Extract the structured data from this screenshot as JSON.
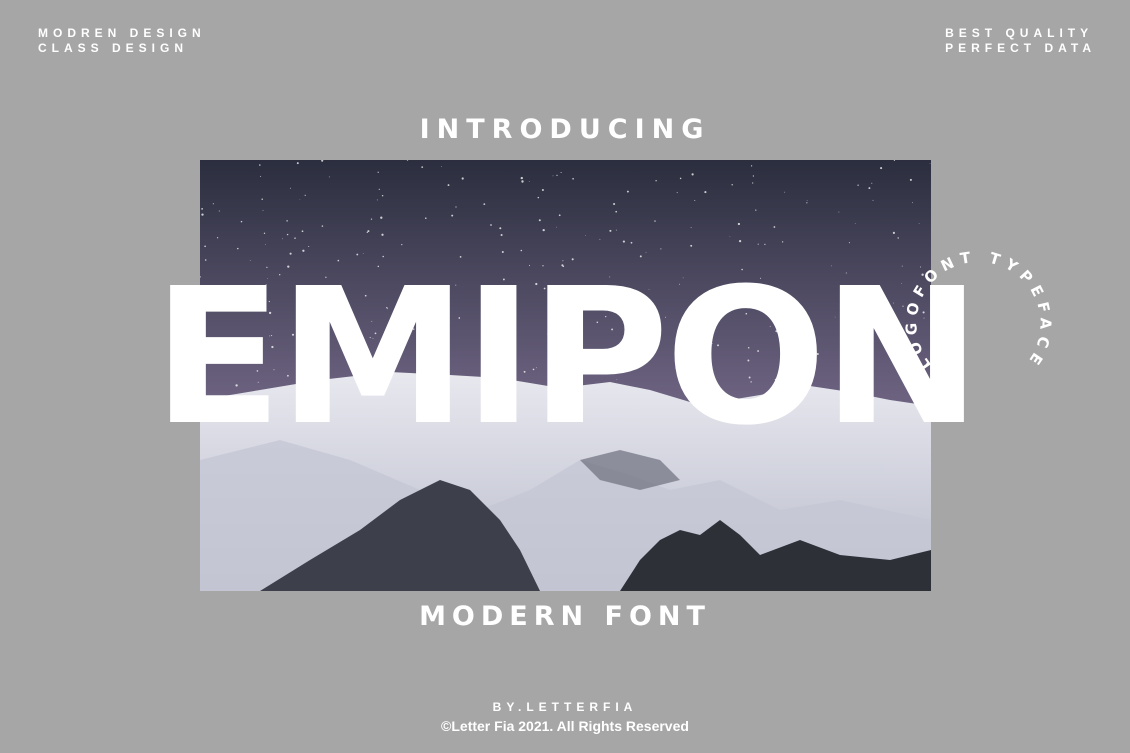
{
  "corners": {
    "top_left": [
      "MODREN DESIGN",
      "CLASS DESIGN"
    ],
    "top_right": [
      "BEST QUALITY",
      "PERFECT DATA"
    ]
  },
  "intro": "INTRODUCING",
  "title": "EMIPON",
  "arc_text": "LOGOFONT TYPEFACE",
  "subtitle": "MODERN FONT",
  "byline": "BY.LETTERFIA",
  "copyright": "©Letter Fia 2021. All Rights Reserved",
  "colors": {
    "background": "#a6a6a6",
    "text": "#ffffff",
    "sky_top": "#2b2e3e",
    "sky_bottom": "#8a7c98",
    "snow": "#e8e8ef"
  }
}
